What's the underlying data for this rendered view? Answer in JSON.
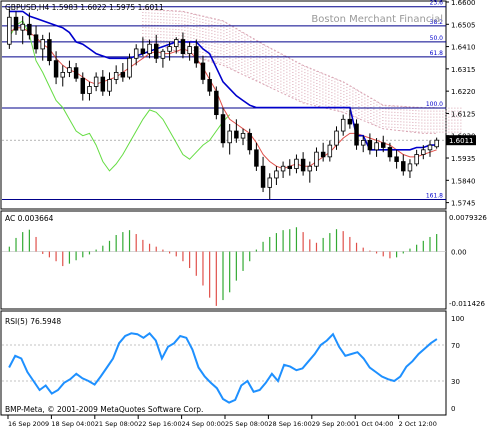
{
  "chart_data": {
    "type": "candlestick",
    "header": {
      "symbol": "GBPUSD,H4",
      "open": "1.5983",
      "high": "1.6022",
      "low": "1.5975",
      "close": "1.6011",
      "text": "GBPUSD,H4  1.5983 1.6022 1.5975 1.6011"
    },
    "watermark": "Boston Merchant Financial",
    "last_price_label": "1.6011",
    "y_ticks": [
      "1.6600",
      "1.6505",
      "1.6410",
      "1.6315",
      "1.6220",
      "1.6125",
      "1.6030",
      "1.5935",
      "1.5840",
      "1.5745"
    ],
    "ylim": [
      1.5722,
      1.66
    ],
    "fibonacci": [
      {
        "label": "23.6",
        "price": 1.658
      },
      {
        "label": "38.2",
        "price": 1.6498
      },
      {
        "label": "50.0",
        "price": 1.643
      },
      {
        "label": "61.8",
        "price": 1.6366
      },
      {
        "label": "100.0",
        "price": 1.6148
      },
      {
        "label": "161.8",
        "price": 1.5758
      }
    ],
    "candles": [
      {
        "o": 1.642,
        "h": 1.657,
        "l": 1.64,
        "c": 1.6535
      },
      {
        "o": 1.6535,
        "h": 1.656,
        "l": 1.646,
        "c": 1.648
      },
      {
        "o": 1.648,
        "h": 1.654,
        "l": 1.642,
        "c": 1.6505
      },
      {
        "o": 1.6505,
        "h": 1.6555,
        "l": 1.644,
        "c": 1.646
      },
      {
        "o": 1.646,
        "h": 1.65,
        "l": 1.638,
        "c": 1.64
      },
      {
        "o": 1.64,
        "h": 1.646,
        "l": 1.635,
        "c": 1.644
      },
      {
        "o": 1.644,
        "h": 1.647,
        "l": 1.633,
        "c": 1.635
      },
      {
        "o": 1.635,
        "h": 1.639,
        "l": 1.625,
        "c": 1.628
      },
      {
        "o": 1.628,
        "h": 1.633,
        "l": 1.624,
        "c": 1.63
      },
      {
        "o": 1.63,
        "h": 1.635,
        "l": 1.628,
        "c": 1.632
      },
      {
        "o": 1.632,
        "h": 1.634,
        "l": 1.626,
        "c": 1.6275
      },
      {
        "o": 1.6275,
        "h": 1.63,
        "l": 1.618,
        "c": 1.621
      },
      {
        "o": 1.621,
        "h": 1.626,
        "l": 1.618,
        "c": 1.624
      },
      {
        "o": 1.624,
        "h": 1.63,
        "l": 1.622,
        "c": 1.628
      },
      {
        "o": 1.628,
        "h": 1.631,
        "l": 1.62,
        "c": 1.622
      },
      {
        "o": 1.622,
        "h": 1.63,
        "l": 1.62,
        "c": 1.627
      },
      {
        "o": 1.627,
        "h": 1.633,
        "l": 1.625,
        "c": 1.63
      },
      {
        "o": 1.63,
        "h": 1.634,
        "l": 1.626,
        "c": 1.628
      },
      {
        "o": 1.628,
        "h": 1.638,
        "l": 1.627,
        "c": 1.636
      },
      {
        "o": 1.636,
        "h": 1.642,
        "l": 1.633,
        "c": 1.64
      },
      {
        "o": 1.64,
        "h": 1.645,
        "l": 1.637,
        "c": 1.638
      },
      {
        "o": 1.638,
        "h": 1.644,
        "l": 1.636,
        "c": 1.642
      },
      {
        "o": 1.642,
        "h": 1.646,
        "l": 1.634,
        "c": 1.636
      },
      {
        "o": 1.636,
        "h": 1.64,
        "l": 1.632,
        "c": 1.639
      },
      {
        "o": 1.639,
        "h": 1.643,
        "l": 1.635,
        "c": 1.641
      },
      {
        "o": 1.641,
        "h": 1.645,
        "l": 1.638,
        "c": 1.644
      },
      {
        "o": 1.644,
        "h": 1.647,
        "l": 1.636,
        "c": 1.638
      },
      {
        "o": 1.638,
        "h": 1.643,
        "l": 1.635,
        "c": 1.641
      },
      {
        "o": 1.641,
        "h": 1.644,
        "l": 1.632,
        "c": 1.634
      },
      {
        "o": 1.634,
        "h": 1.637,
        "l": 1.625,
        "c": 1.627
      },
      {
        "o": 1.627,
        "h": 1.63,
        "l": 1.62,
        "c": 1.622
      },
      {
        "o": 1.622,
        "h": 1.624,
        "l": 1.61,
        "c": 1.612
      },
      {
        "o": 1.612,
        "h": 1.615,
        "l": 1.598,
        "c": 1.6
      },
      {
        "o": 1.6,
        "h": 1.608,
        "l": 1.595,
        "c": 1.605
      },
      {
        "o": 1.605,
        "h": 1.61,
        "l": 1.6,
        "c": 1.602
      },
      {
        "o": 1.602,
        "h": 1.606,
        "l": 1.599,
        "c": 1.604
      },
      {
        "o": 1.604,
        "h": 1.606,
        "l": 1.595,
        "c": 1.597
      },
      {
        "o": 1.597,
        "h": 1.6,
        "l": 1.588,
        "c": 1.59
      },
      {
        "o": 1.59,
        "h": 1.594,
        "l": 1.579,
        "c": 1.581
      },
      {
        "o": 1.581,
        "h": 1.587,
        "l": 1.576,
        "c": 1.585
      },
      {
        "o": 1.585,
        "h": 1.59,
        "l": 1.582,
        "c": 1.588
      },
      {
        "o": 1.588,
        "h": 1.592,
        "l": 1.585,
        "c": 1.59
      },
      {
        "o": 1.59,
        "h": 1.593,
        "l": 1.586,
        "c": 1.589
      },
      {
        "o": 1.589,
        "h": 1.595,
        "l": 1.587,
        "c": 1.593
      },
      {
        "o": 1.593,
        "h": 1.596,
        "l": 1.586,
        "c": 1.588
      },
      {
        "o": 1.588,
        "h": 1.592,
        "l": 1.583,
        "c": 1.59
      },
      {
        "o": 1.59,
        "h": 1.598,
        "l": 1.588,
        "c": 1.596
      },
      {
        "o": 1.596,
        "h": 1.6,
        "l": 1.592,
        "c": 1.594
      },
      {
        "o": 1.594,
        "h": 1.601,
        "l": 1.592,
        "c": 1.599
      },
      {
        "o": 1.599,
        "h": 1.607,
        "l": 1.597,
        "c": 1.605
      },
      {
        "o": 1.605,
        "h": 1.612,
        "l": 1.603,
        "c": 1.61
      },
      {
        "o": 1.61,
        "h": 1.614,
        "l": 1.606,
        "c": 1.608
      },
      {
        "o": 1.608,
        "h": 1.61,
        "l": 1.597,
        "c": 1.599
      },
      {
        "o": 1.599,
        "h": 1.603,
        "l": 1.596,
        "c": 1.601
      },
      {
        "o": 1.601,
        "h": 1.604,
        "l": 1.595,
        "c": 1.597
      },
      {
        "o": 1.597,
        "h": 1.602,
        "l": 1.594,
        "c": 1.6
      },
      {
        "o": 1.6,
        "h": 1.603,
        "l": 1.596,
        "c": 1.598
      },
      {
        "o": 1.598,
        "h": 1.6,
        "l": 1.592,
        "c": 1.594
      },
      {
        "o": 1.594,
        "h": 1.597,
        "l": 1.589,
        "c": 1.592
      },
      {
        "o": 1.592,
        "h": 1.595,
        "l": 1.586,
        "c": 1.588
      },
      {
        "o": 1.588,
        "h": 1.593,
        "l": 1.585,
        "c": 1.591
      },
      {
        "o": 1.591,
        "h": 1.597,
        "l": 1.59,
        "c": 1.595
      },
      {
        "o": 1.595,
        "h": 1.599,
        "l": 1.593,
        "c": 1.597
      },
      {
        "o": 1.597,
        "h": 1.601,
        "l": 1.594,
        "c": 1.599
      },
      {
        "o": 1.5983,
        "h": 1.6022,
        "l": 1.5975,
        "c": 1.6011
      }
    ],
    "ichimoku_kumo": [
      {
        "i": 20,
        "a": 1.657,
        "b": 1.644
      },
      {
        "i": 26,
        "a": 1.656,
        "b": 1.638
      },
      {
        "i": 32,
        "a": 1.652,
        "b": 1.633
      },
      {
        "i": 38,
        "a": 1.642,
        "b": 1.625
      },
      {
        "i": 44,
        "a": 1.633,
        "b": 1.617
      },
      {
        "i": 50,
        "a": 1.626,
        "b": 1.613
      },
      {
        "i": 56,
        "a": 1.616,
        "b": 1.606
      },
      {
        "i": 62,
        "a": 1.615,
        "b": 1.604
      },
      {
        "i": 64,
        "a": 1.615,
        "b": 1.604
      }
    ],
    "tenkan_sen": [
      1.647,
      1.649,
      1.649,
      1.647,
      1.645,
      1.642,
      1.64,
      1.636,
      1.633,
      1.631,
      1.63,
      1.628,
      1.626,
      1.625,
      1.626,
      1.627,
      1.628,
      1.63,
      1.632,
      1.634,
      1.636,
      1.638,
      1.639,
      1.638,
      1.638,
      1.639,
      1.64,
      1.639,
      1.636,
      1.632,
      1.627,
      1.622,
      1.615,
      1.61,
      1.608,
      1.606,
      1.604,
      1.6,
      1.595,
      1.592,
      1.59,
      1.589,
      1.59,
      1.591,
      1.59,
      1.59,
      1.592,
      1.594,
      1.596,
      1.599,
      1.602,
      1.604,
      1.604,
      1.603,
      1.602,
      1.601,
      1.6,
      1.599,
      1.597,
      1.595,
      1.594,
      1.594,
      1.595,
      1.596,
      1.597
    ],
    "kijun_sen": [
      1.656,
      1.656,
      1.656,
      1.654,
      1.653,
      1.652,
      1.651,
      1.65,
      1.649,
      1.647,
      1.643,
      1.642,
      1.64,
      1.638,
      1.637,
      1.636,
      1.636,
      1.636,
      1.636,
      1.637,
      1.638,
      1.639,
      1.64,
      1.641,
      1.642,
      1.643,
      1.643,
      1.643,
      1.643,
      1.64,
      1.638,
      1.632,
      1.626,
      1.623,
      1.62,
      1.618,
      1.616,
      1.615,
      1.615,
      1.615,
      1.615,
      1.615,
      1.615,
      1.615,
      1.615,
      1.615,
      1.615,
      1.615,
      1.615,
      1.615,
      1.615,
      1.615,
      1.603,
      1.603,
      1.597,
      1.597,
      1.597,
      1.597,
      1.597,
      1.597,
      1.597,
      1.598,
      1.598,
      1.599,
      1.599
    ],
    "chikou_span": [
      1.645,
      1.65,
      1.652,
      1.646,
      1.635,
      1.63,
      1.624,
      1.618,
      1.615,
      1.61,
      1.605,
      1.603,
      1.604,
      1.599,
      1.592,
      1.588,
      1.591,
      1.595,
      1.6,
      1.605,
      1.61,
      1.614,
      1.613,
      1.61,
      1.605,
      1.6,
      1.595,
      1.593,
      1.596,
      1.599,
      1.601,
      1.605,
      1.609,
      1.612
    ],
    "ac": {
      "label": "AC 0.003664",
      "top_label": "0.0079326",
      "zero_label": "0.00",
      "bottom_label": "-0.011426",
      "ylim": [
        -0.011426,
        0.0079326
      ],
      "values": [
        0.001,
        0.0028,
        0.004,
        0.0045,
        0.003,
        -0.0005,
        -0.0012,
        -0.002,
        -0.003,
        -0.0025,
        -0.0018,
        -0.0012,
        -0.0006,
        0.0004,
        0.0012,
        0.0022,
        0.0034,
        0.004,
        0.0044,
        0.0036,
        0.0024,
        0.0016,
        0.001,
        0.0004,
        -0.0004,
        -0.001,
        -0.002,
        -0.0034,
        -0.005,
        -0.007,
        -0.0095,
        -0.0112,
        -0.01,
        -0.0084,
        -0.006,
        -0.004,
        -0.002,
        0.0004,
        0.002,
        0.003,
        0.0038,
        0.0044,
        0.0046,
        0.005,
        0.004,
        0.0025,
        0.0018,
        0.0028,
        0.0038,
        0.0046,
        0.0042,
        0.003,
        0.0018,
        0.0008,
        0.0002,
        -0.0004,
        -0.001,
        -0.0014,
        -0.0012,
        -0.0004,
        0.0006,
        0.0014,
        0.0022,
        0.003,
        0.0036
      ]
    },
    "rsi": {
      "label": "RSI(5) 76.5948",
      "levels": [
        100,
        70,
        30,
        0
      ],
      "ylim": [
        0,
        100
      ],
      "values": [
        45,
        58,
        55,
        40,
        30,
        20,
        25,
        16,
        20,
        28,
        32,
        38,
        33,
        30,
        26,
        35,
        45,
        55,
        72,
        80,
        83,
        82,
        78,
        83,
        75,
        55,
        68,
        72,
        80,
        78,
        65,
        45,
        35,
        28,
        22,
        10,
        6,
        9,
        25,
        30,
        18,
        20,
        28,
        38,
        30,
        48,
        46,
        42,
        44,
        52,
        60,
        70,
        75,
        82,
        68,
        58,
        60,
        62,
        55,
        45,
        40,
        35,
        32,
        30,
        35,
        46,
        52,
        60,
        66,
        72,
        76.6
      ]
    },
    "x_labels": [
      "16 Sep 2009",
      "18 Sep 04:00",
      "21 Sep 08:00",
      "22 Sep 16:00",
      "24 Sep 00:00",
      "25 Sep 08:00",
      "28 Sep 16:00",
      "29 Sep 20:00",
      "1 Oct 04:00",
      "2 Oct 12:00"
    ],
    "copyright": "BMP-Meta, © 2001-2009 MetaQuotes Software Corp."
  }
}
